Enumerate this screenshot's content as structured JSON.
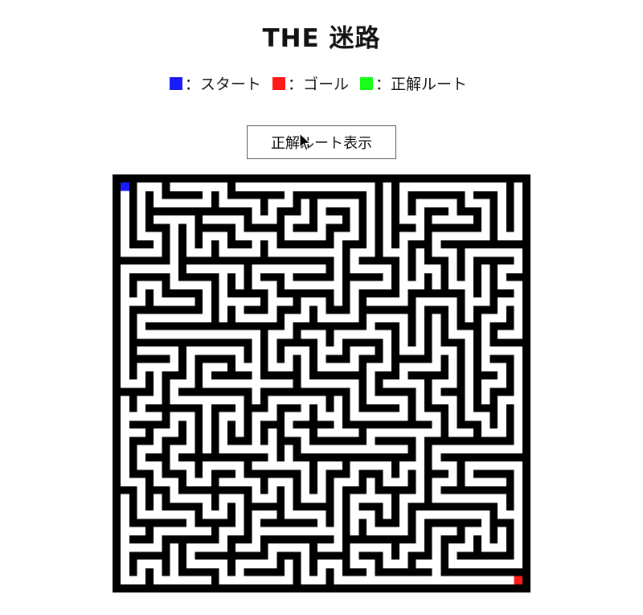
{
  "title": "THE 迷路",
  "legend": [
    {
      "label": "：スタート",
      "color": "#1a1aff"
    },
    {
      "label": "：ゴール",
      "color": "#ff1a1a"
    },
    {
      "label": "：正解ルート",
      "color": "#1aff1a"
    }
  ],
  "button_label": "正解ルート表示",
  "maze": {
    "cols": 25,
    "rows": 25,
    "wall_color": "#000000",
    "path_color": "#ffffff",
    "start_color": "#1a1aff",
    "goal_color": "#ff1a1a",
    "solution_color": "#1aff1a",
    "solution_shown": false
  }
}
